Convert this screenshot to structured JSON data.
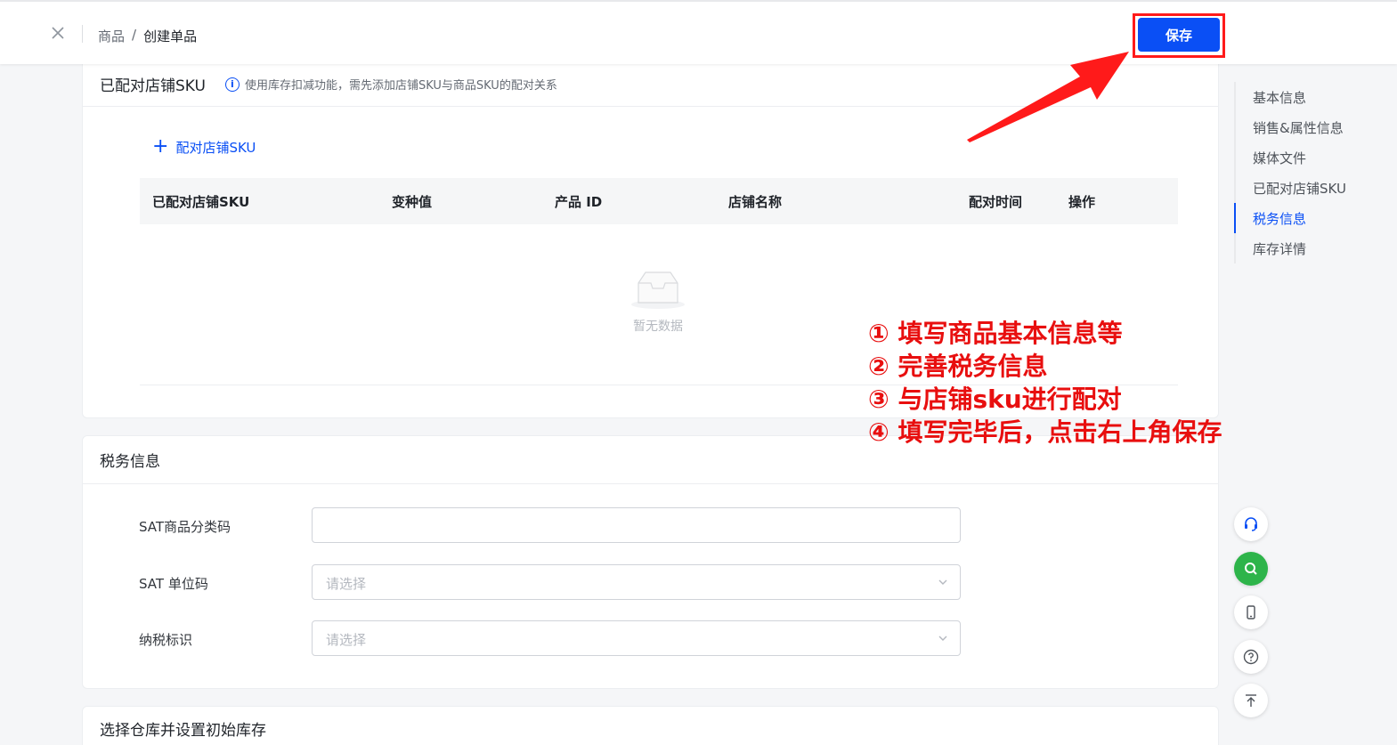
{
  "header": {
    "breadcrumb": [
      "商品",
      "/",
      "创建单品"
    ],
    "save_label": "保存"
  },
  "pair_section": {
    "title": "已配对店铺SKU",
    "hint": "使用库存扣减功能，需先添加店铺SKU与商品SKU的配对关系",
    "add_link": "配对店铺SKU",
    "columns": [
      "已配对店铺SKU",
      "变种值",
      "产品 ID",
      "店铺名称",
      "配对时间",
      "操作"
    ],
    "empty_text": "暂无数据"
  },
  "tax_section": {
    "title": "税务信息",
    "fields": [
      {
        "label": "SAT商品分类码",
        "value": ""
      },
      {
        "label": "SAT 单位码",
        "placeholder": "请选择"
      },
      {
        "label": "纳税标识",
        "placeholder": "请选择"
      }
    ]
  },
  "warehouse_section": {
    "title": "选择仓库并设置初始库存"
  },
  "anchor_nav": {
    "items": [
      "基本信息",
      "销售&属性信息",
      "媒体文件",
      "已配对店铺SKU",
      "税务信息",
      "库存详情"
    ],
    "active": "税务信息"
  },
  "float_buttons": [
    "headset-icon",
    "search-icon",
    "mobile-icon",
    "help-icon",
    "back-to-top-icon"
  ],
  "annotations": [
    "① 填写商品基本信息等",
    "② 完善税务信息",
    "③ 与店铺sku进行配对",
    "④ 填写完毕后，点击右上角保存"
  ],
  "colors": {
    "primary": "#0a4ff5",
    "annotation_red": "#e80f0f",
    "green": "#2db44a"
  }
}
